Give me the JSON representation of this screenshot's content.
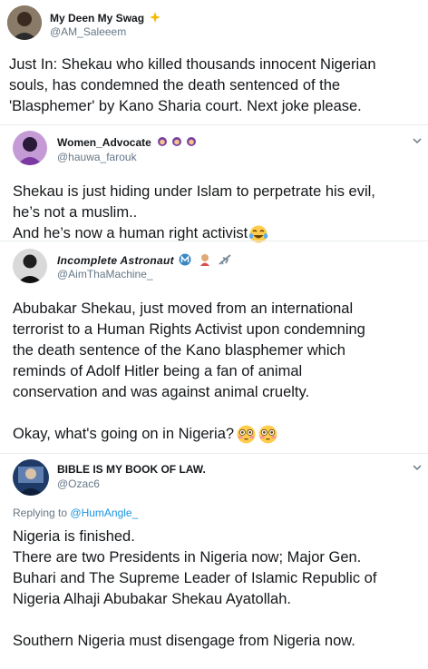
{
  "tweets": [
    {
      "name": "My Deen My Swag",
      "handle": "@AM_Saleeem",
      "lines": [
        "Just In: Shekau who killed thousands innocent Nigerian",
        "souls, has condemned the death sentenced of the",
        "'Blasphemer' by Kano Sharia court. Next joke please."
      ]
    },
    {
      "name": "Women_Advocate",
      "handle": "@hauwa_farouk",
      "lines": [
        "Shekau is just hiding under Islam to perpetrate his evil,",
        "he’s not a muslim..",
        "And he’s now a human right activist"
      ]
    },
    {
      "name": "Incomplete Astronaut",
      "handle": "@AimThaMachine_",
      "lines": [
        "Abubakar Shekau, just moved from an international",
        "terrorist to a Human Rights Activist upon condemning",
        "the death sentence of the Kano blasphemer which",
        "reminds of Adolf Hitler being a fan of animal",
        "conservation and was against animal cruelty.",
        "",
        "Okay, what's going on in Nigeria?"
      ]
    },
    {
      "name": "BIBLE IS MY BOOK OF LAW.",
      "handle": "@Ozac6",
      "replying_prefix": "Replying to",
      "replying_to": "@HumAngle_",
      "lines": [
        "Nigeria is finished.",
        "There are two Presidents in Nigeria now; Major Gen.",
        "Buhari and The Supreme Leader of Islamic Republic of",
        "Nigeria Alhaji Abubakar Shekau Ayatollah.",
        "",
        "Southern Nigeria must disengage from Nigeria now."
      ]
    }
  ],
  "icons": {
    "menu": "chevron-down-icon",
    "flushed_face": "flushed-face-emoji",
    "laughing_face": "tears-of-joy-emoji"
  },
  "colors": {
    "text": "#14171a",
    "secondary": "#657786",
    "link": "#1b95e0",
    "divider": "#e6ecf0"
  }
}
